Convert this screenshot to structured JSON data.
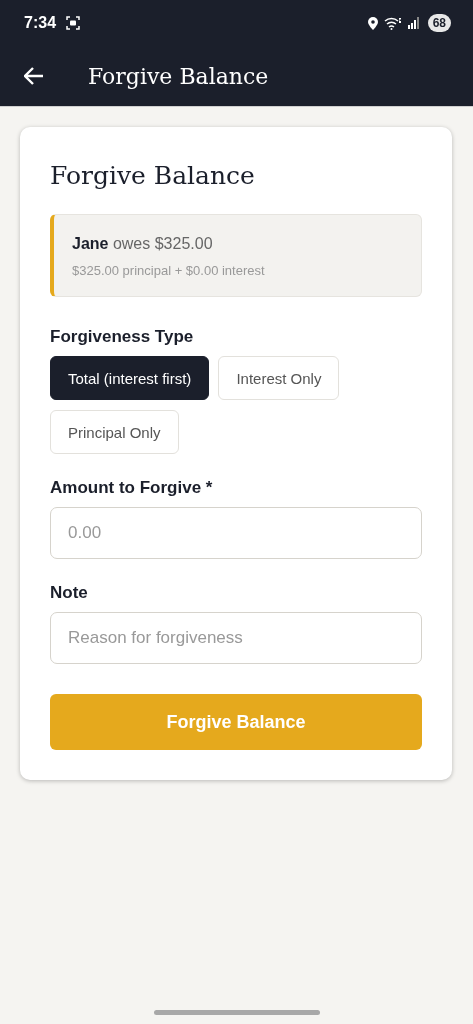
{
  "status_bar": {
    "time": "7:34",
    "battery": "68"
  },
  "app_bar": {
    "title": "Forgive Balance"
  },
  "card": {
    "title": "Forgive Balance",
    "summary": {
      "headline": "**Jane** owes $325.00",
      "detail": "$325.00 principal + $0.00 interest"
    },
    "type_label": "Forgiveness Type",
    "types": [
      {
        "label": "Total (interest first)",
        "selected": true
      },
      {
        "label": "Interest Only",
        "selected": false
      },
      {
        "label": "Principal Only",
        "selected": false
      }
    ],
    "amount": {
      "label": "Amount to Forgive *",
      "placeholder": "0.00"
    },
    "note": {
      "label": "Note",
      "placeholder": "Reason for forgiveness"
    },
    "submit": "Forgive Balance"
  }
}
